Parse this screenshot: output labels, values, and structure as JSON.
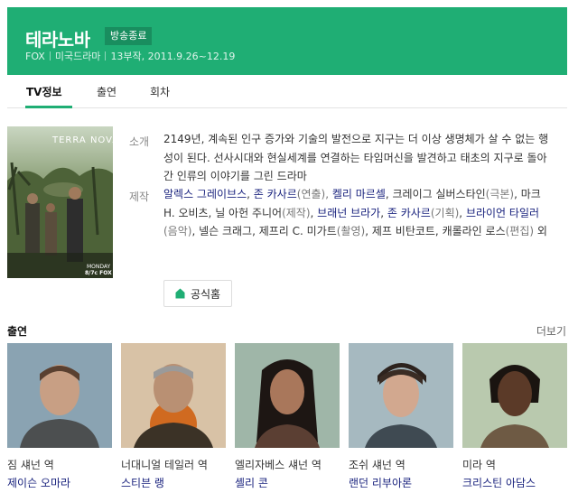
{
  "header": {
    "title": "테라노바",
    "badge": "방송종료",
    "network": "FOX",
    "genre": "미국드라마",
    "episodes_dates": "13부작, 2011.9.26~12.19",
    "color": "#1fae74"
  },
  "tabs": [
    {
      "label": "TV정보",
      "active": true
    },
    {
      "label": "출연",
      "active": false
    },
    {
      "label": "회차",
      "active": false
    }
  ],
  "poster": {
    "title_text": "TERRA NOVA",
    "corner_text_1": "MONDAY",
    "corner_text_2": "8/7c FOX"
  },
  "info": {
    "synopsis_label": "소개",
    "synopsis": "2149년, 계속된 인구 증가와 기술의 발전으로 지구는 더 이상 생명체가 살 수 없는 행성이 된다. 선사시대와 현실세계를 연결하는 타임머신을 발견하고 태초의 지구로 돌아간 인류의 이야기를 그린 드라마",
    "credits_label": "제작",
    "credits": {
      "c1": "알렉스 그레이브스",
      "c2": ", ",
      "c3": "존 카사르",
      "c4": "(연출), ",
      "c5": "켈리 마르셀",
      "c6": ", 크레이그 실버스타인",
      "c7": "(극본)",
      "c8": ", 마크 H. 오비츠, 닐 아헌 주니어",
      "c9": "(제작)",
      "c10": ", ",
      "c11": "브래넌 브라가",
      "c12": ", ",
      "c13": "존 카사르",
      "c14": "(기획)",
      "c15": ", ",
      "c16": "브라이언 타일러",
      "c17": "(음악)",
      "c18": ", 넬슨 크래그, 제프리 C. 미가트",
      "c19": "(촬영)",
      "c20": ", 제프 비탄코트, 캐롤라인 로스",
      "c21": "(편집)",
      "c22": " 외"
    },
    "homepage_label": "공식홈"
  },
  "cast": {
    "title": "출연",
    "more": "더보기",
    "members": [
      {
        "role": "짐 섀넌 역",
        "actor": "제이슨 오마라"
      },
      {
        "role": "너대니얼 테일러 역",
        "actor": "스티븐 랭"
      },
      {
        "role": "엘리자베스 섀넌 역",
        "actor": "셸리 콘"
      },
      {
        "role": "조쉬 섀넌 역",
        "actor": "랜던 리부아론"
      },
      {
        "role": "미라 역",
        "actor": "크리스틴 아담스"
      }
    ]
  }
}
